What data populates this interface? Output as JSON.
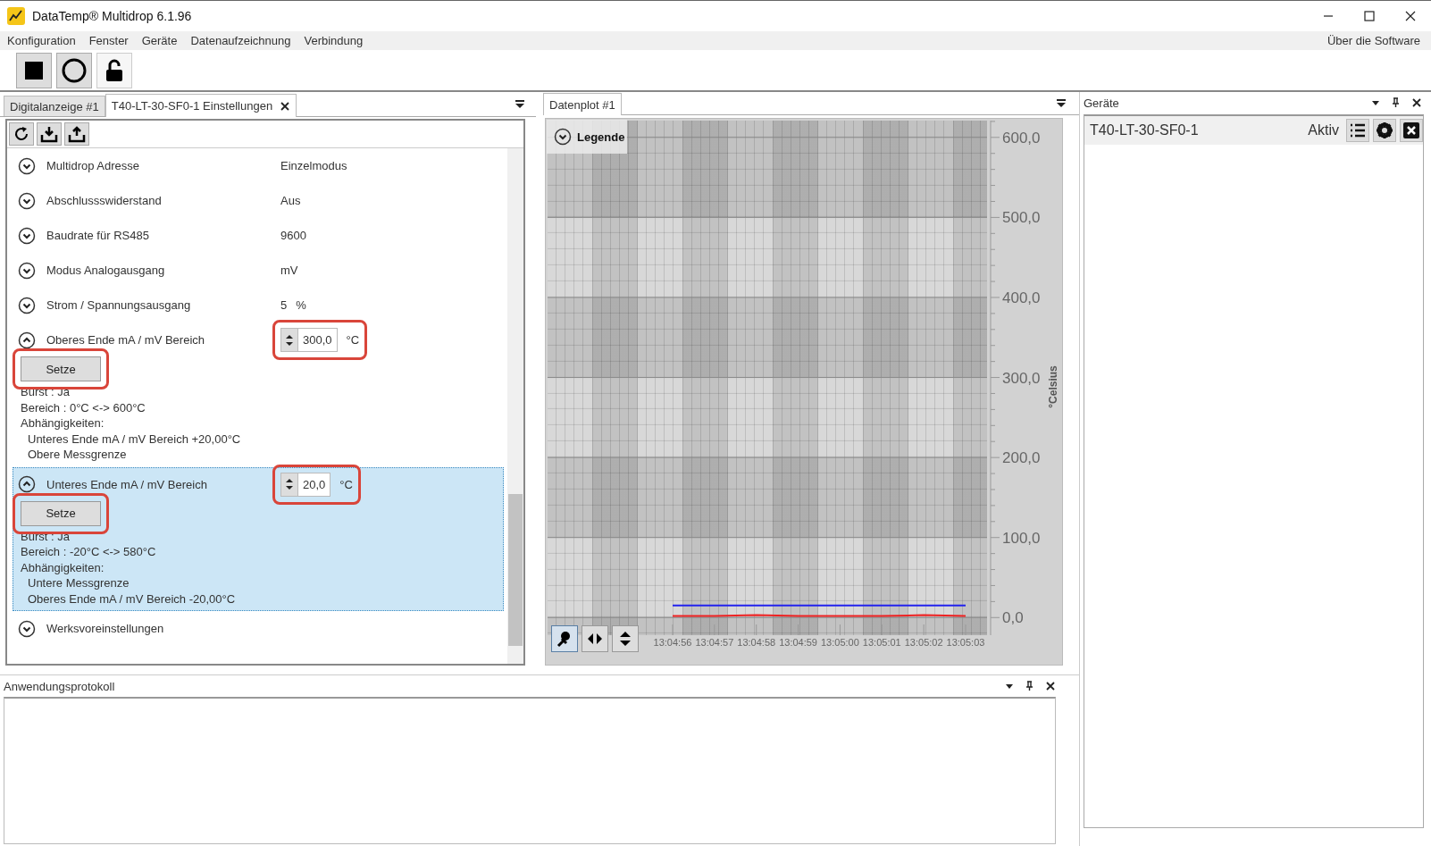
{
  "window": {
    "title": "DataTemp® Multidrop 6.1.96"
  },
  "menu": [
    {
      "label": "Konfiguration"
    },
    {
      "label": "Fenster"
    },
    {
      "label": "Geräte"
    },
    {
      "label": "Datenaufzeichnung"
    },
    {
      "label": "Verbindung"
    }
  ],
  "menu_right": "Über die Software",
  "settings_pane": {
    "tabs": [
      {
        "label": "Digitalanzeige #1",
        "selected": false,
        "closable": false
      },
      {
        "label": "T40-LT-30-SF0-1 Einstellungen",
        "selected": true,
        "closable": true
      }
    ],
    "settings": [
      {
        "label": "Multidrop Adresse",
        "kind": "text",
        "value": "Einzelmodus",
        "expanded": false,
        "selected": false
      },
      {
        "label": "Abschlussswiderstand",
        "kind": "text",
        "value": "Aus",
        "expanded": false,
        "selected": false
      },
      {
        "label": "Baudrate für RS485",
        "kind": "text",
        "value": "9600",
        "expanded": false,
        "selected": false
      },
      {
        "label": "Modus Analogausgang",
        "kind": "text",
        "value": "mV",
        "expanded": false,
        "selected": false
      },
      {
        "label": "Strom / Spannungsausgang",
        "kind": "text",
        "value": "5",
        "unit": "%",
        "expanded": false,
        "selected": false
      },
      {
        "label": "Oberes Ende mA  / mV Bereich",
        "kind": "spinner",
        "value": "300,0",
        "unit": "°C",
        "expanded": true,
        "selected": false,
        "annotated": true,
        "button": "Setze",
        "details": [
          "Burst : Ja",
          "Bereich : 0°C <-> 600°C"
        ],
        "dependencies_label": "Abhängigkeiten:",
        "dependencies": [
          "Unteres Ende mA / mV Bereich +20,00°C",
          "Obere Messgrenze"
        ]
      },
      {
        "label": "Unteres Ende mA / mV Bereich",
        "kind": "spinner",
        "value": "20,0",
        "unit": "°C",
        "expanded": true,
        "selected": true,
        "annotated": true,
        "button": "Setze",
        "details": [
          "Burst : Ja",
          "Bereich : -20°C <-> 580°C"
        ],
        "dependencies_label": "Abhängigkeiten:",
        "dependencies": [
          "Untere Messgrenze",
          "Oberes Ende mA  / mV Bereich -20,00°C"
        ]
      },
      {
        "label": "Werksvoreinstellungen",
        "kind": "none",
        "expanded": false,
        "selected": false
      }
    ]
  },
  "plot_pane": {
    "tab": {
      "label": "Datenplot #1",
      "selected": true
    },
    "legend": {
      "label": "Legende",
      "expanded": false
    },
    "chart_data": {
      "type": "line",
      "grid": true,
      "ylabel": "°Celsius",
      "ylim": [
        -22,
        621
      ],
      "yticks": [
        {
          "value": 0,
          "label": "0,0"
        },
        {
          "value": 100,
          "label": "100,0"
        },
        {
          "value": 200,
          "label": "200,0"
        },
        {
          "value": 300,
          "label": "300,0"
        },
        {
          "value": 400,
          "label": "400,0"
        },
        {
          "value": 500,
          "label": "500,0"
        },
        {
          "value": 600,
          "label": "600,0"
        }
      ],
      "categories": [
        "13:04:56",
        "13:04:57",
        "13:04:58",
        "13:04:59",
        "13:05:00",
        "13:05:01",
        "13:05:02",
        "13:05:03"
      ],
      "series": [
        {
          "color": "#2222ee",
          "values": [
            15,
            15,
            15,
            15,
            15,
            15,
            15,
            15
          ]
        },
        {
          "color": "#ee2222",
          "values": [
            2,
            2,
            3,
            2,
            2,
            2,
            3,
            2
          ]
        }
      ]
    }
  },
  "devices_pane": {
    "title": "Geräte",
    "devices": [
      {
        "name": "T40-LT-30-SF0-1",
        "status": "Aktiv"
      }
    ]
  },
  "log_pane": {
    "title": "Anwendungsprotokoll"
  }
}
